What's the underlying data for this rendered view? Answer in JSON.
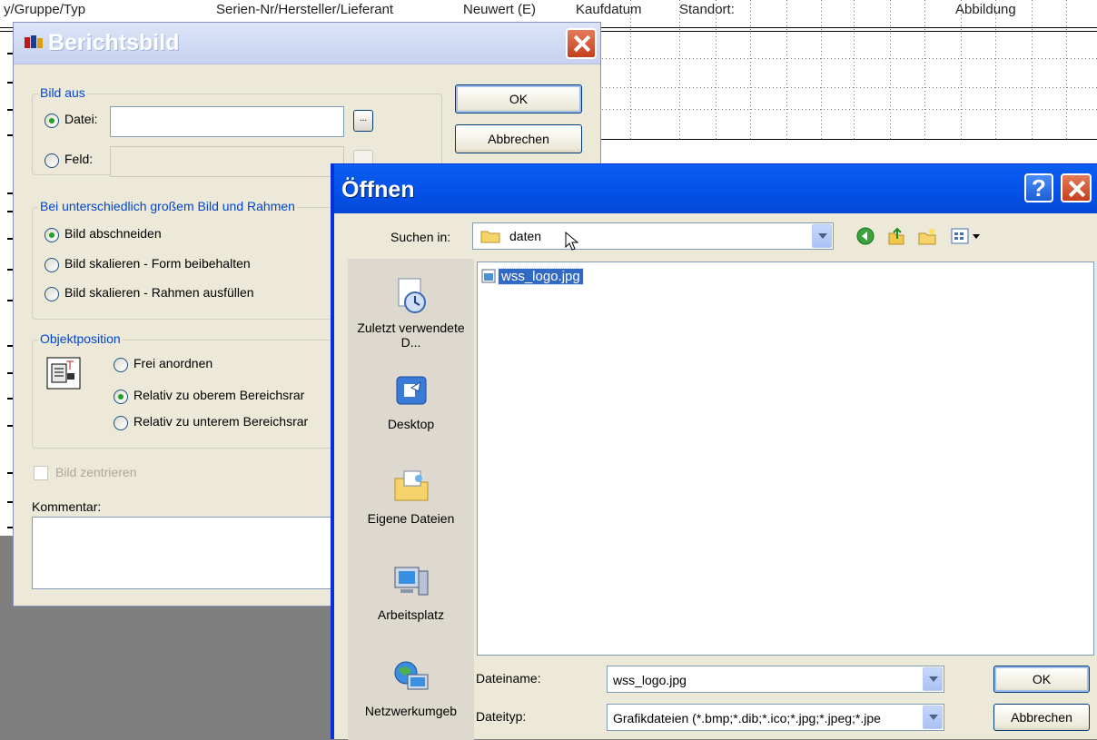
{
  "report": {
    "header_cols": [
      "y/Gruppe/Typ",
      "Serien-Nr/Hersteller/Lieferant",
      "Neuwert (E)",
      "Kaufdatum",
      "Standort:",
      "Abbildung"
    ]
  },
  "berichtsbild": {
    "title": "Berichtsbild",
    "bild_aus_label": "Bild aus",
    "datei_label": "Datei:",
    "datei_value": "",
    "feld_label": "Feld:",
    "browse_label": "...",
    "ok_label": "OK",
    "cancel_label": "Abbrechen",
    "size_group_label": "Bei unterschiedlich großem Bild und Rahmen",
    "size_options": [
      "Bild abschneiden",
      "Bild skalieren - Form beibehalten",
      "Bild skalieren - Rahmen ausfüllen"
    ],
    "size_selected": 0,
    "position_group_label": "Objektposition",
    "position_options": [
      "Frei anordnen",
      "Relativ zu oberem Bereichsrar",
      "Relativ zu unterem Bereichsrar"
    ],
    "position_selected": 1,
    "center_label": "Bild zentrieren",
    "comment_label": "Kommentar:",
    "comment_value": ""
  },
  "open_dialog": {
    "title": "Öffnen",
    "look_in_label": "Suchen in:",
    "look_in_value": "daten",
    "places": [
      {
        "label": "Zuletzt verwendete D...",
        "icon": "recent-documents-icon"
      },
      {
        "label": "Desktop",
        "icon": "desktop-icon"
      },
      {
        "label": "Eigene Dateien",
        "icon": "my-documents-icon"
      },
      {
        "label": "Arbeitsplatz",
        "icon": "my-computer-icon"
      },
      {
        "label": "Netzwerkumgeb",
        "icon": "network-places-icon"
      }
    ],
    "files": [
      {
        "name": "wss_logo.jpg",
        "selected": true
      }
    ],
    "filename_label": "Dateiname:",
    "filename_value": "wss_logo.jpg",
    "filetype_label": "Dateityp:",
    "filetype_value": "Grafikdateien (*.bmp;*.dib;*.ico;*.jpg;*.jpeg;*.jpe",
    "ok_label": "OK",
    "cancel_label": "Abbrechen",
    "help_label": "?"
  },
  "colors": {
    "xp_title_blue": "#0553ea",
    "group_label_blue": "#0046d5",
    "selection_blue": "#316ac5",
    "dialog_face": "#ece9d8"
  }
}
